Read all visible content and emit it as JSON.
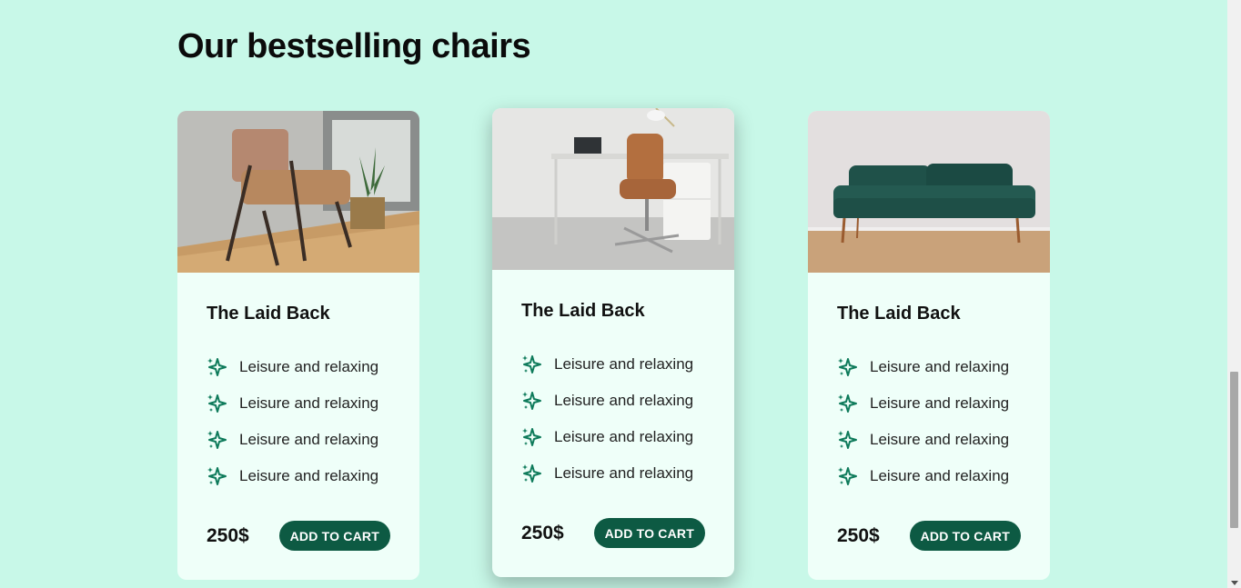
{
  "section": {
    "title": "Our bestselling chairs"
  },
  "cards": [
    {
      "image": "lounge-chair-photo",
      "title": "The Laid Back",
      "features": [
        "Leisure and relaxing",
        "Leisure and relaxing",
        "Leisure and relaxing",
        "Leisure and relaxing"
      ],
      "price": "250$",
      "button": "ADD TO CART"
    },
    {
      "image": "office-chair-photo",
      "title": "The Laid Back",
      "features": [
        "Leisure and relaxing",
        "Leisure and relaxing",
        "Leisure and relaxing",
        "Leisure and relaxing"
      ],
      "price": "250$",
      "button": "ADD TO CART"
    },
    {
      "image": "green-sofa-photo",
      "title": "The Laid Back",
      "features": [
        "Leisure and relaxing",
        "Leisure and relaxing",
        "Leisure and relaxing",
        "Leisure and relaxing"
      ],
      "price": "250$",
      "button": "ADD TO CART"
    }
  ],
  "feature_icon": "sparkles-icon",
  "colors": {
    "background": "#c8f8e8",
    "card": "#effff9",
    "accent": "#0d5a43"
  }
}
